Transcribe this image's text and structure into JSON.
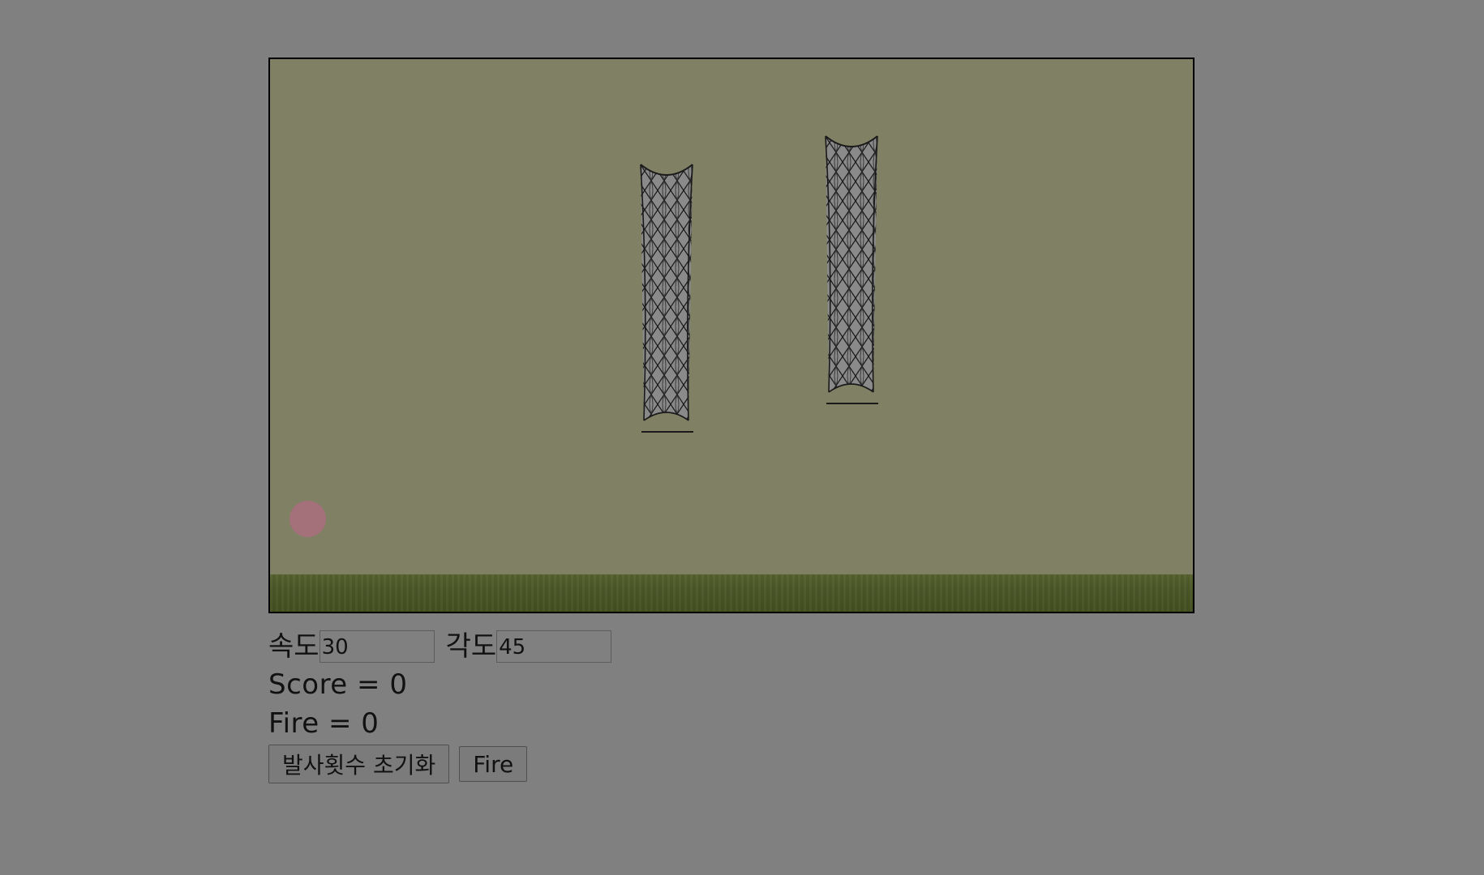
{
  "game": {
    "ball_color": "#a4707a",
    "background_color": "#7f8064",
    "ground_color": "#4b5628"
  },
  "controls": {
    "speed_label": "속도",
    "speed_value": "30",
    "angle_label": "각도",
    "angle_value": "45"
  },
  "stats": {
    "score_text": "Score = 0",
    "fire_text": "Fire = 0"
  },
  "buttons": {
    "reset_label": "발사횟수 초기화",
    "fire_label": "Fire"
  }
}
